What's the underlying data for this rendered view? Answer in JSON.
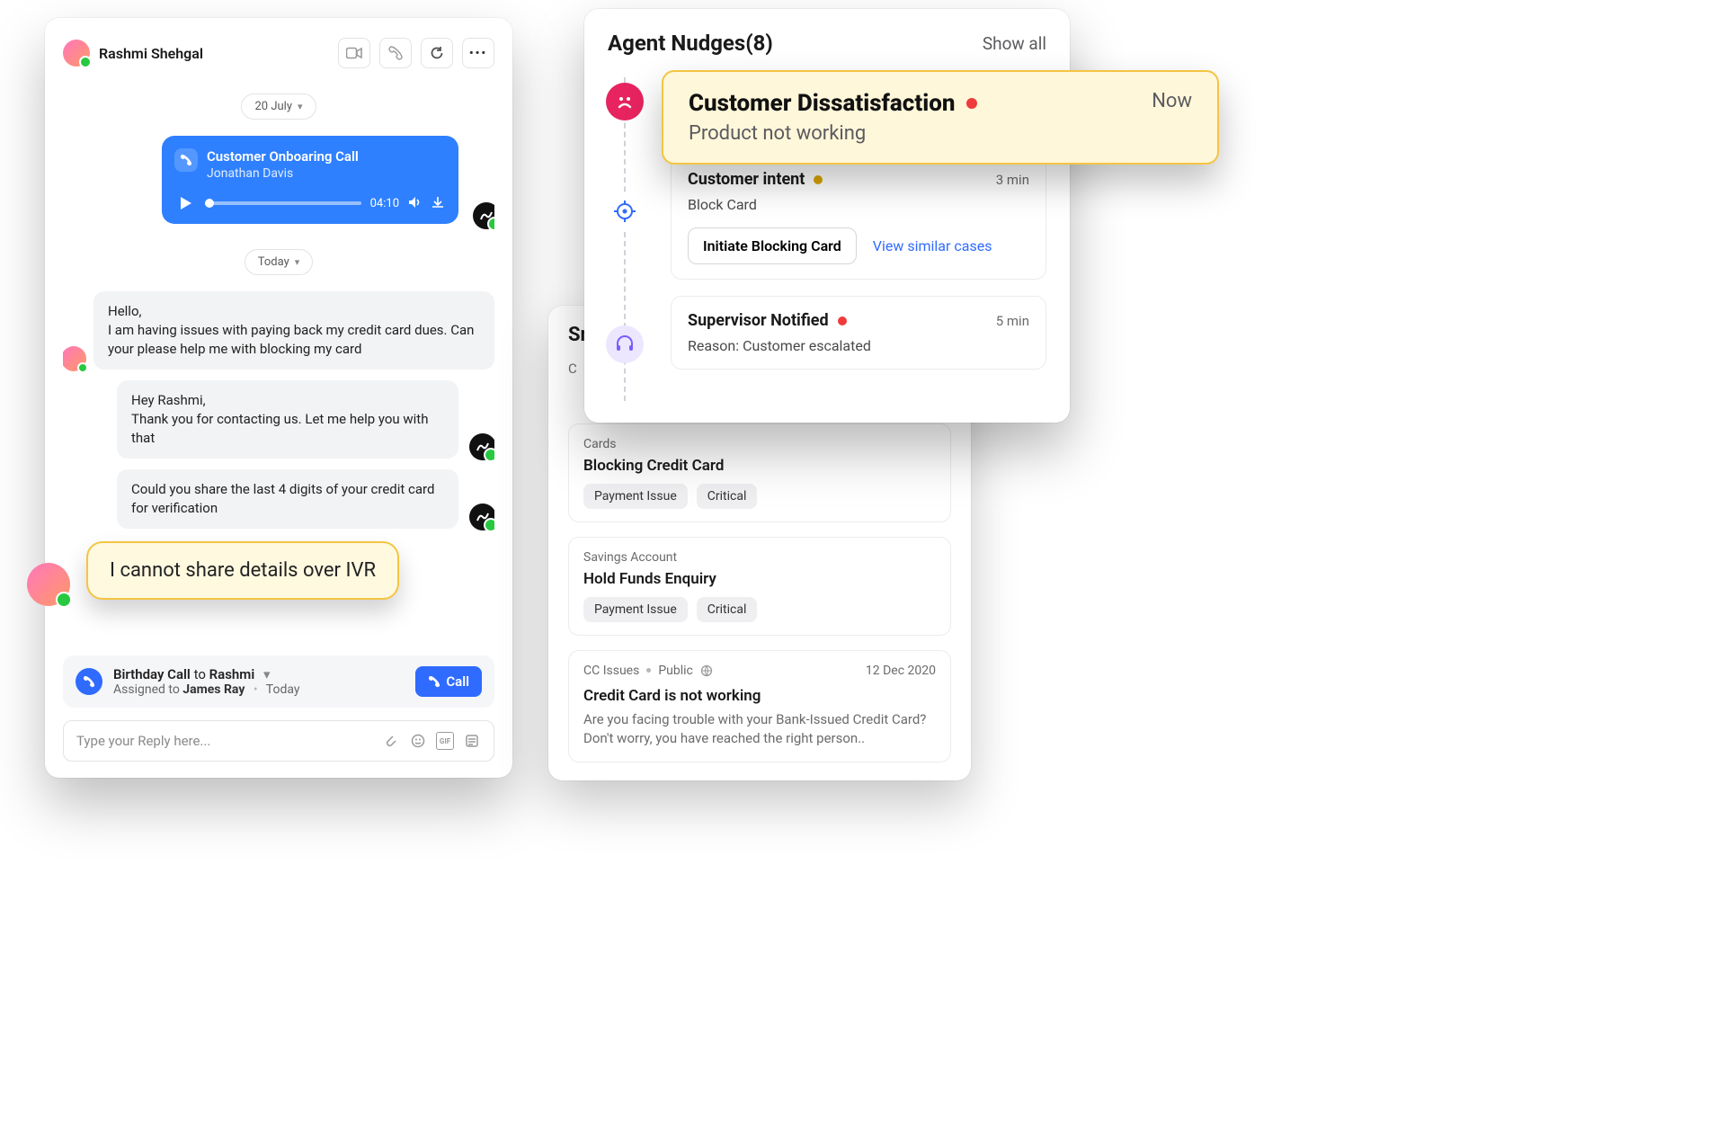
{
  "chat": {
    "user_name": "Rashmi Shehgal",
    "date_pill_1": "20 July",
    "date_pill_2": "Today",
    "audio": {
      "title": "Customer Onboaring Call",
      "subtitle": "Jonathan Davis",
      "duration": "04:10"
    },
    "msgs": {
      "m1": "Hello,\nI am having issues with paying back my credit card dues. Can your please help me with blocking my card",
      "m2": "Hey Rashmi,\nThank you for contacting us. Let me help you with that",
      "m3": "Could you share the last 4 digits of your credit card for verification",
      "highlight": "I cannot share details over IVR"
    },
    "call_strip": {
      "label_prefix": "Birthday Call",
      "label_to": "to",
      "label_name": "Rashmi",
      "assigned_prefix": "Assigned to",
      "assigned_name": "James Ray",
      "assigned_when": "Today",
      "button": "Call"
    },
    "reply_placeholder": "Type your Reply here..."
  },
  "cases": {
    "heading_partial": "Sm",
    "c_partial": "C",
    "blocks": [
      {
        "eyebrow": "Cards",
        "title": "Blocking Credit Card",
        "chips": [
          "Payment Issue",
          "Critical"
        ]
      },
      {
        "eyebrow": "Savings Account",
        "title": "Hold Funds Enquiry",
        "chips": [
          "Payment Issue",
          "Critical"
        ]
      }
    ],
    "article": {
      "cat": "CC Issues",
      "vis": "Public",
      "date": "12 Dec 2020",
      "title": "Credit Card is not working",
      "desc": "Are you facing trouble with your Bank-Issued Credit Card? Don't worry, you have reached the right person.."
    }
  },
  "nudges": {
    "title": "Agent Nudges(8)",
    "show_all": "Show all",
    "hero": {
      "title": "Customer Dissatisfaction",
      "sub": "Product not working",
      "time": "Now"
    },
    "items": [
      {
        "title": "Customer intent",
        "dot": "amber",
        "time": "3 min",
        "sub": "Block Card",
        "action": "Initiate Blocking Card",
        "link": "View similar cases"
      },
      {
        "title": "Supervisor Notified",
        "dot": "red",
        "time": "5 min",
        "sub": "Reason: Customer escalated"
      }
    ]
  }
}
